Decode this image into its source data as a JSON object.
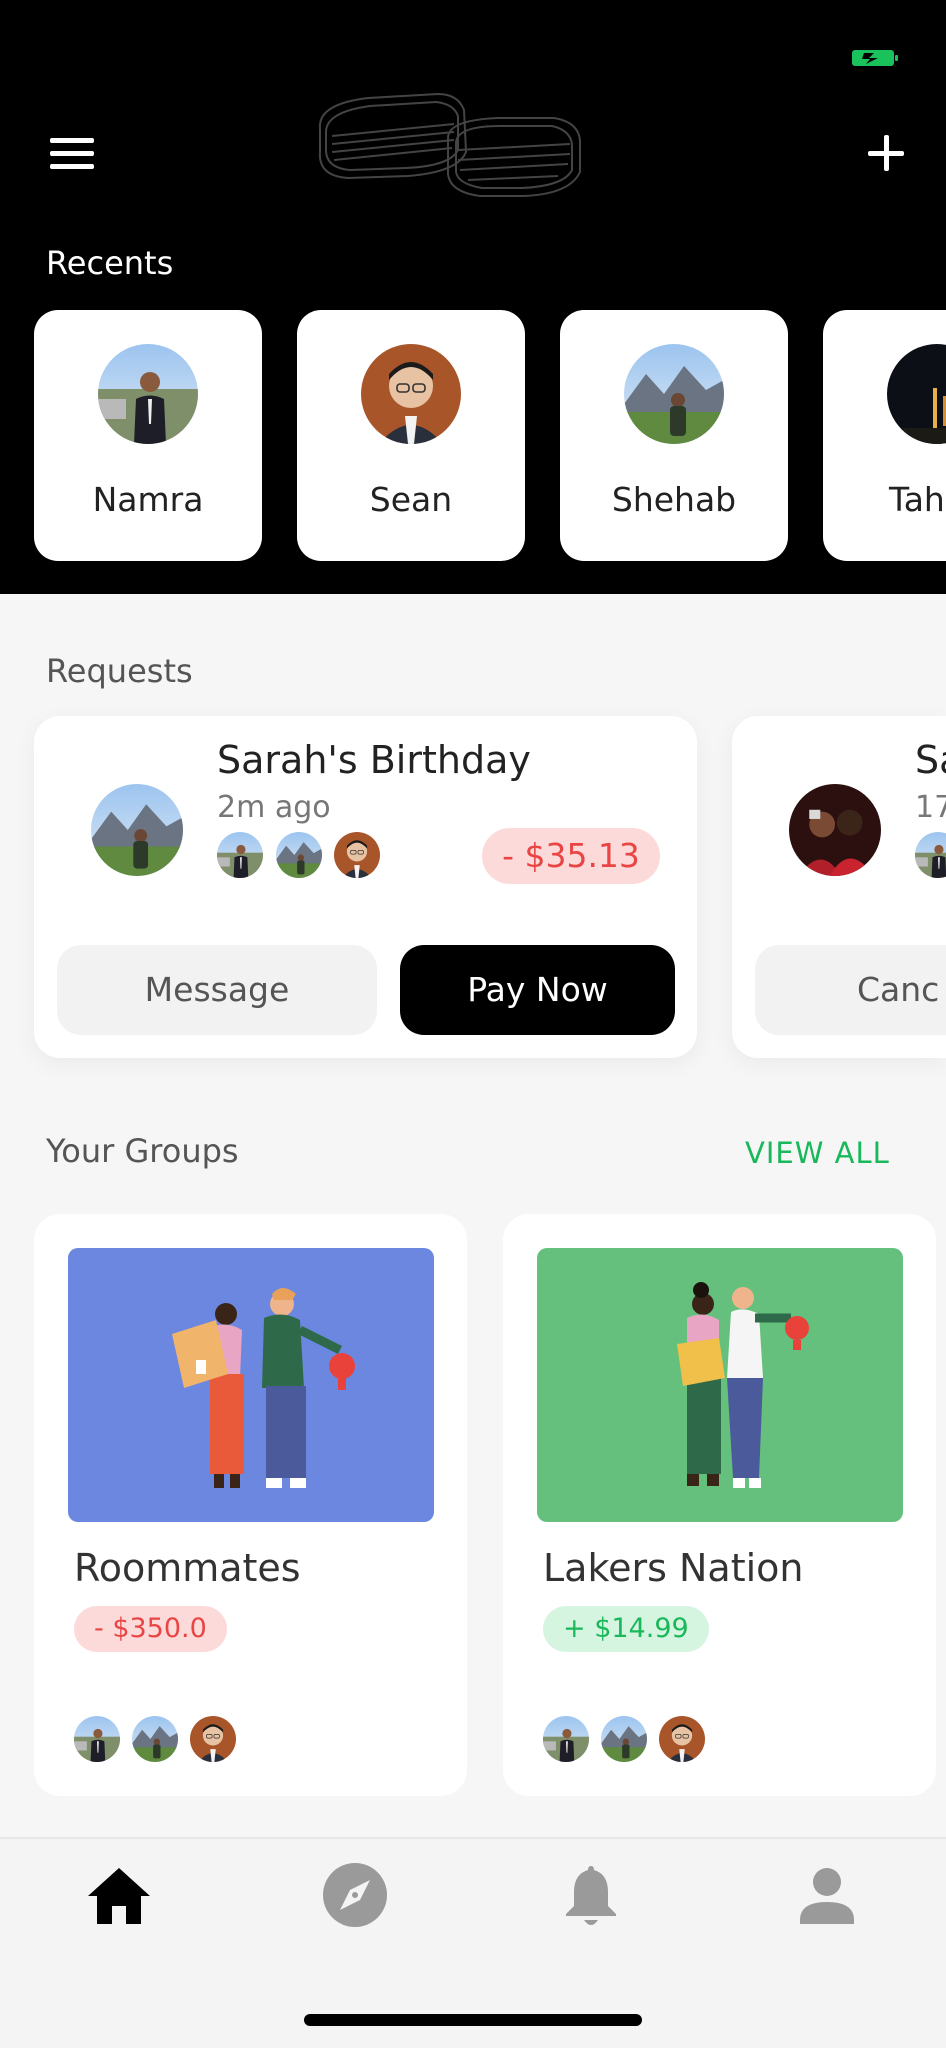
{
  "header": {
    "logo_alt": "logo"
  },
  "recents": {
    "title": "Recents",
    "people": [
      {
        "name": "Namra"
      },
      {
        "name": "Sean"
      },
      {
        "name": "Shehab"
      },
      {
        "name": "Tah"
      }
    ]
  },
  "requests": {
    "title": "Requests",
    "cards": [
      {
        "title": "Sarah's Birthday",
        "time": "2m ago",
        "amount": "- $35.13",
        "secondary_button": "Message",
        "primary_button": "Pay Now"
      },
      {
        "title": "Sa",
        "time": "17",
        "secondary_button": "Canc"
      }
    ]
  },
  "groups": {
    "title": "Your Groups",
    "view_all": "VIEW ALL",
    "items": [
      {
        "name": "Roommates",
        "balance": "- $350.0",
        "balance_type": "negative",
        "illustration_bg": "#6b87df"
      },
      {
        "name": "Lakers Nation",
        "balance": "+ $14.99",
        "balance_type": "positive",
        "illustration_bg": "#64c07c"
      }
    ]
  },
  "tabbar": {
    "tabs": [
      {
        "icon": "home-icon",
        "active": true
      },
      {
        "icon": "compass-icon",
        "active": false
      },
      {
        "icon": "bell-icon",
        "active": false
      },
      {
        "icon": "person-icon",
        "active": false
      }
    ]
  },
  "colors": {
    "accent_green": "#19b85a",
    "negative_red": "#e94545",
    "negative_bg": "#fddada",
    "positive_bg": "#d6f5e0",
    "header_bg": "#000000"
  }
}
